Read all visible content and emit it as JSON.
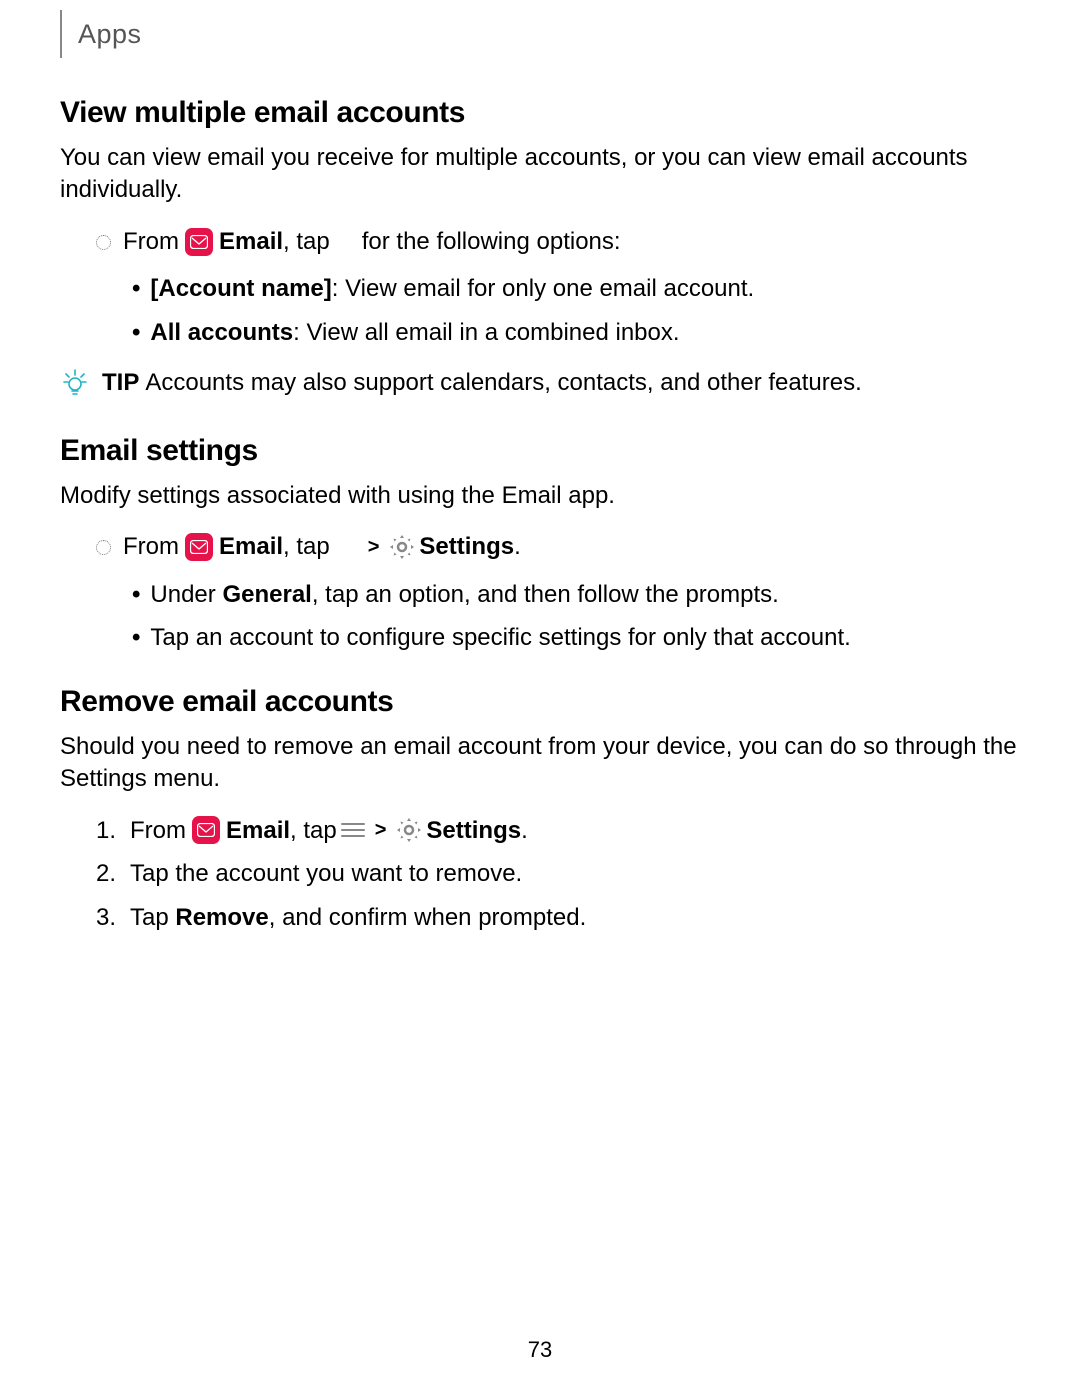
{
  "header": {
    "breadcrumb": "Apps"
  },
  "section1": {
    "title": "View multiple email accounts",
    "intro": "You can view email you receive for multiple accounts, or you can view email accounts individually.",
    "step_from": "From ",
    "email_label": "Email",
    "step_tap": ", tap ",
    "step_after": " for the following options:",
    "bullets": [
      {
        "bold": "[Account name]",
        "rest": ": View email for only one email account."
      },
      {
        "bold": "All accounts",
        "rest": ": View all email in a combined inbox."
      }
    ],
    "tip_label": "TIP",
    "tip_text": "  Accounts may also support calendars, contacts, and other features."
  },
  "section2": {
    "title": "Email settings",
    "intro": "Modify settings associated with using the Email app.",
    "step_from": "From ",
    "email_label": "Email",
    "step_tap": ", tap ",
    "settings_label": "Settings",
    "period": ".",
    "bullets": [
      {
        "pre": "Under ",
        "bold": "General",
        "rest": ", tap an option, and then follow the prompts."
      },
      {
        "pre": "",
        "bold": "",
        "rest": "Tap an account to configure specific settings for only that account."
      }
    ]
  },
  "section3": {
    "title": "Remove email accounts",
    "intro": "Should you need to remove an email account from your device, you can do so through the Settings menu.",
    "steps": {
      "n1": "1.",
      "step_from": "From ",
      "email_label": "Email",
      "step_tap": ", tap ",
      "settings_label": "Settings",
      "period": ".",
      "n2": "2.",
      "s2": "Tap the account you want to remove.",
      "n3": "3.",
      "s3_pre": "Tap ",
      "s3_bold": "Remove",
      "s3_rest": ", and confirm when prompted."
    }
  },
  "page_number": "73",
  "chevron": ">"
}
